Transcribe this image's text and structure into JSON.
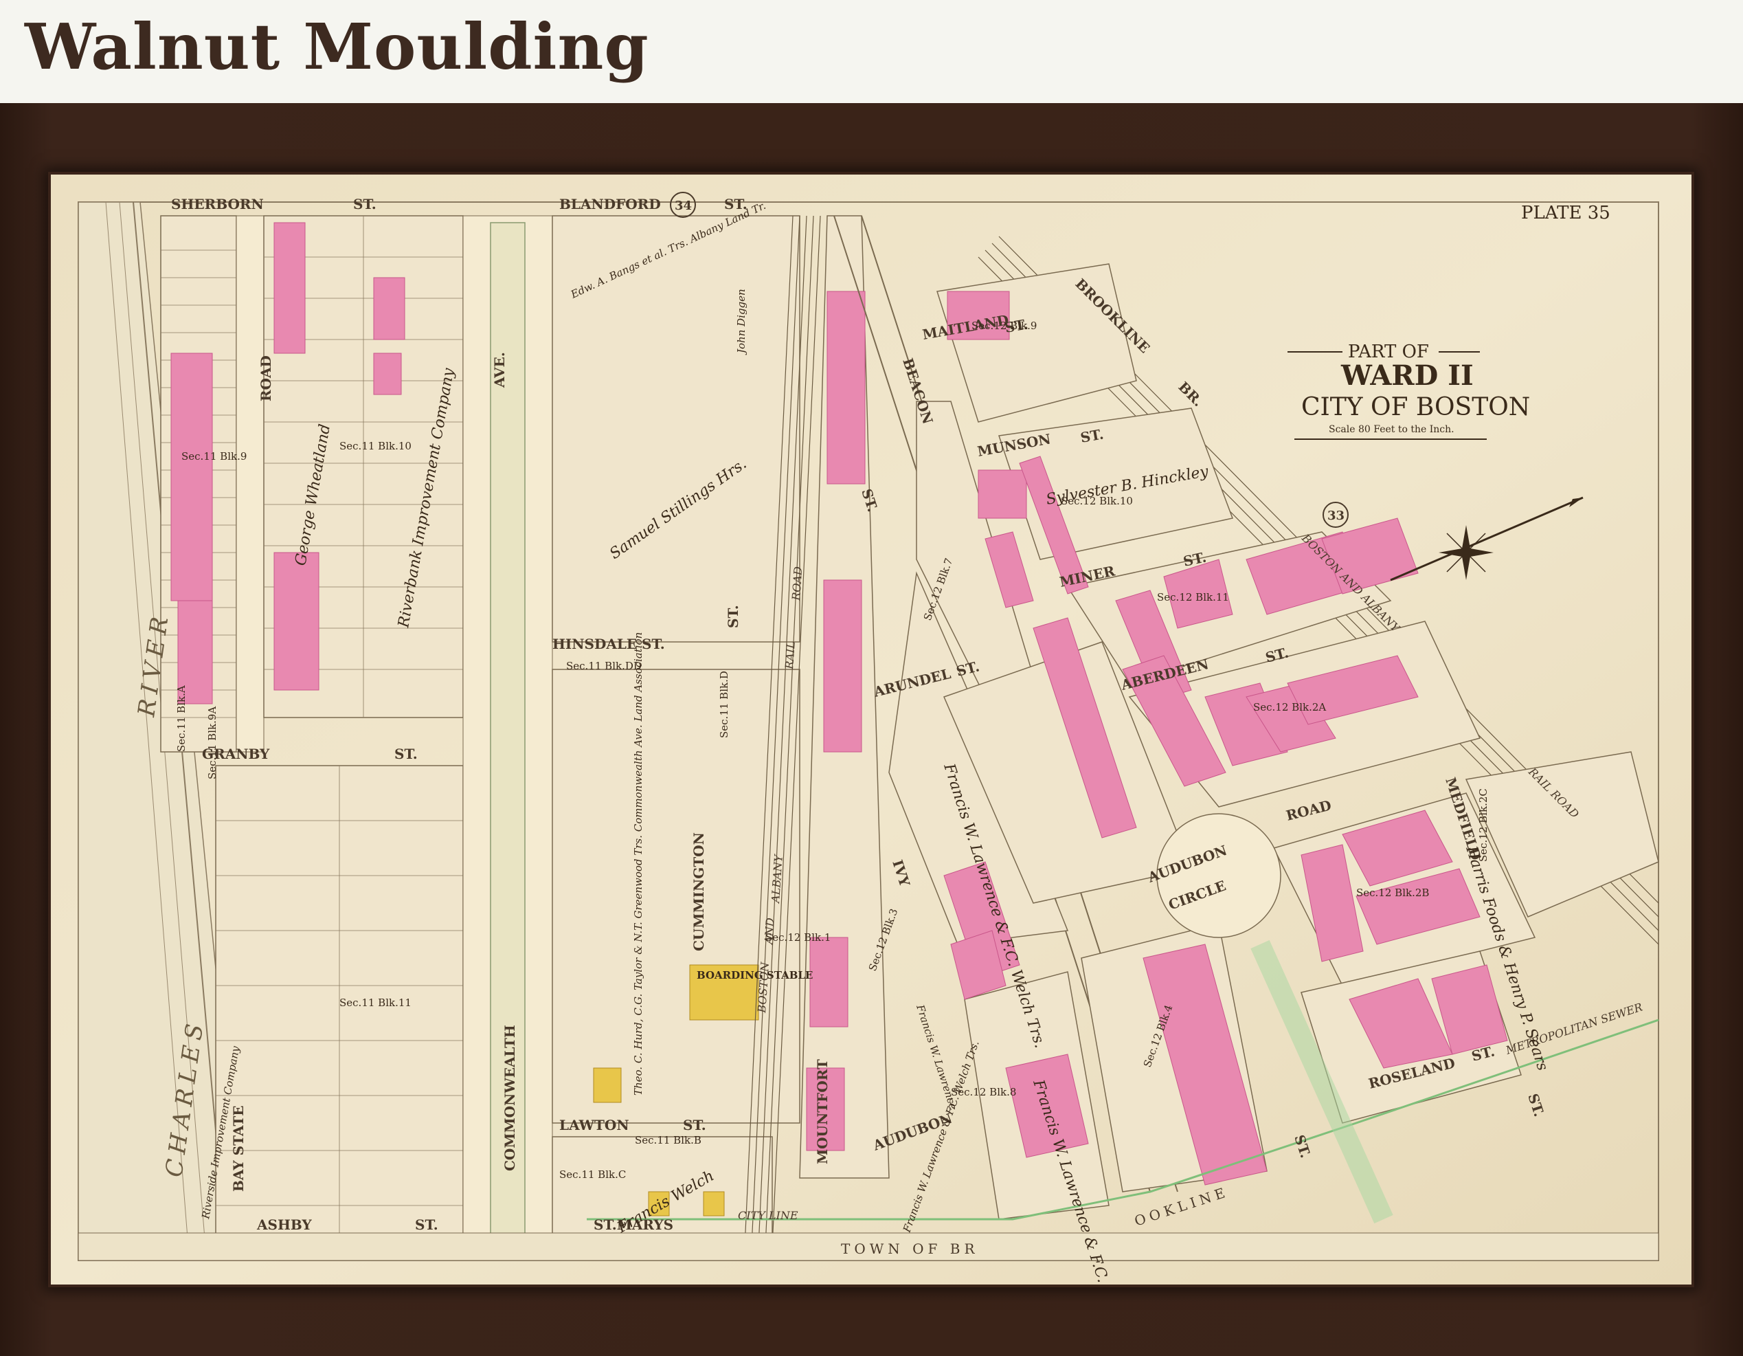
{
  "header": {
    "title": "Walnut Moulding"
  },
  "map": {
    "plate": "PLATE 35",
    "cartouche": {
      "line1": "PART OF",
      "line2": "WARD II",
      "line3": "CITY OF BOSTON",
      "scale": "Scale 80 Feet to the Inch."
    },
    "plate_numbers": {
      "a": "34",
      "b": "33"
    },
    "streets": {
      "sherborn": "SHERBORN",
      "st1": "ST.",
      "blandford": "BLANDFORD",
      "st2": "ST.",
      "maitland": "MAITLAND",
      "st_maitland": "ST.",
      "brookline": "BROOKLINE",
      "br": "BR.",
      "road1": "ROAD",
      "ave": "AVE.",
      "beacon": "BEACON",
      "munson": "MUNSON",
      "st_munson": "ST.",
      "hinsdale": "HINSDALE",
      "st_hinsdale": "ST.",
      "miner": "MINER",
      "st_miner": "ST.",
      "arundel": "ARUNDEL",
      "st_arundel": "ST.",
      "aberdeen": "ABERDEEN",
      "st_aberdeen": "ST.",
      "granby": "GRANBY",
      "st_granby": "ST.",
      "cummington": "CUMMINGTON",
      "st_cumm": "ST.",
      "ivy": "IVY",
      "road2": "ROAD",
      "medfield": "MEDFIELD",
      "audubon_circle_1": "AUDUBON",
      "audubon_circle_2": "CIRCLE",
      "lawton": "LAWTON",
      "st_lawton": "ST.",
      "bay_state": "BAY STATE",
      "commonwealth": "COMMONWEALTH",
      "mountfort": "MOUNTFORT",
      "st_mount": "ST.",
      "audubon": "AUDUBON",
      "roseland": "ROSELAND",
      "st_roseland": "ST.",
      "st_rose2": "ST.",
      "st_audubon": "ST.",
      "ashby": "ASHBY",
      "st_ashby": "ST.",
      "st_marys": "ST.MARYS",
      "town": "TOWN   OF   BR",
      "brookline_town": "OOKLINE",
      "charles": "CHARLES",
      "river": "RIVER",
      "boston": "BOSTON",
      "and": "AND",
      "albany": "ALBANY",
      "rail": "RAIL",
      "road_rr": "ROAD",
      "boston_albany_2": "BOSTON AND ALBANY",
      "rail_road_2": "RAIL ROAD",
      "metropolitan_sewer": "METROPOLITAN SEWER",
      "city_line": "CITY LINE"
    },
    "sections": {
      "s1": "Sec.11 Blk.9",
      "s2": "Sec.11 Blk.10",
      "s3": "Sec.11 Blk.DD",
      "s4": "Sec.11 Blk.D",
      "s5": "Sec.11 Blk.11",
      "s6": "Sec.11 Blk.C",
      "s7": "Sec.11 Blk.B",
      "s8": "Sec.12 Blk.1",
      "s9": "Sec.12 Blk.9",
      "s10": "Sec.12 Blk.10",
      "s11": "Sec.12 Blk.11",
      "s12": "Sec.12 Blk.2A",
      "s13": "Sec.12 Blk.2B",
      "s14": "Sec.12 Blk.2C",
      "s15": "Sec.12 Blk.3",
      "s16": "Sec.12 Blk.4",
      "s17": "Sec.12 Blk.8",
      "s18": "Sec.12 Blk.7",
      "s19": "Sec.11 Blk.A",
      "s20": "Sec.11 Blk.9A"
    },
    "owners": {
      "o1": "Samuel Stillings Hrs.",
      "o2": "George Wheatland",
      "o3": "Riverbank Improvement Company",
      "o4": "Francis W. Lawrence & F.C. Welch Trs.",
      "o5": "Sylvester B. Hinckley",
      "o6": "Edw. A. Bangs et al. Trs. Albany Land Tr.",
      "o7": "John Diggen",
      "o8": "Riverside Improvement Company",
      "o9": "Francis W. Lawrence & F.C. Welch Trs.",
      "o10": "Theo. C. Hurd, C.G. Taylor & N.T. Greenwood Trs. Commonwealth Ave. Land Association",
      "o11": "Francis W. Lawrence & F.C. Welch Trs.",
      "o12": "Harris Foods & Henry P. Sears",
      "o13": "Francis Welch",
      "o14": "BOARDING STABLE",
      "o15": "Francis W. Lawrence"
    },
    "colors": {
      "paper": "#efe4c8",
      "street": "#f3e7c6",
      "block": "#f0e5cc",
      "pink": "#e889b0",
      "pink_dark": "#c9568a",
      "yellow": "#e8c64a",
      "green": "#7fbf7a",
      "ink": "#4a3a2a",
      "frame": "#3a2318"
    },
    "icons": {
      "compass": "compass-rose-icon"
    }
  }
}
